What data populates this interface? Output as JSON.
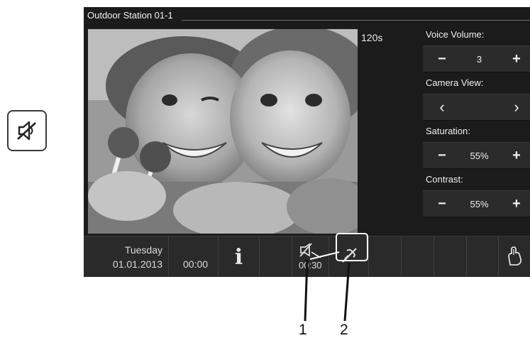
{
  "header": {
    "station_title": "Outdoor Station 01-1"
  },
  "video": {
    "call_timer": "120s"
  },
  "settings": {
    "voice_volume": {
      "label": "Voice Volume:",
      "value": "3",
      "minus": "−",
      "plus": "+"
    },
    "camera_view": {
      "label": "Camera View:",
      "prev": "‹",
      "next": "›"
    },
    "saturation": {
      "label": "Saturation:",
      "value": "55%",
      "minus": "−",
      "plus": "+"
    },
    "contrast": {
      "label": "Contrast:",
      "value": "55%",
      "minus": "−",
      "plus": "+"
    }
  },
  "status_bar": {
    "day": "Tuesday",
    "date": "01.01.2013",
    "clock": "00:00",
    "info_glyph": "i",
    "record_time": "00:30"
  },
  "callouts": {
    "one": "1",
    "two": "2"
  },
  "icons": {
    "side": "speaker-mute-icon",
    "record": "camera-mute-icon",
    "mic": "mic-mute-icon",
    "unlock": "hand-unlock-icon"
  },
  "colors": {
    "screen_bg": "#1b1b1b",
    "bar_bg": "#2a2a2a",
    "text": "#eaeaea"
  }
}
